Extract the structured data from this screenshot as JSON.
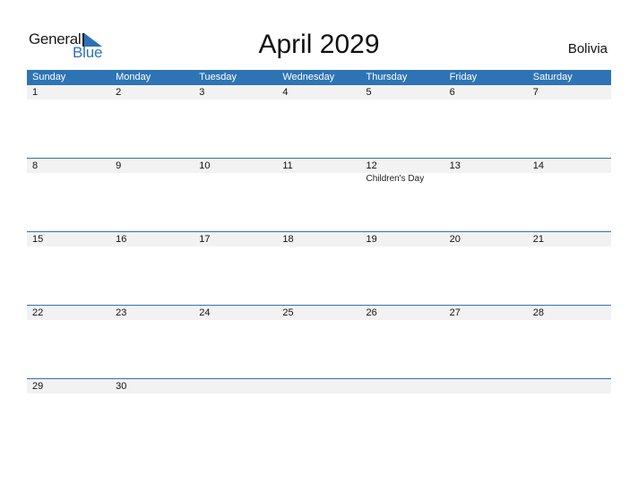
{
  "logo": {
    "part1": "General",
    "part2": "Blue"
  },
  "title": "April 2029",
  "country": "Bolivia",
  "colors": {
    "accent": "#2e74b5",
    "band": "#f2f2f2"
  },
  "weekdays": [
    "Sunday",
    "Monday",
    "Tuesday",
    "Wednesday",
    "Thursday",
    "Friday",
    "Saturday"
  ],
  "weeks": [
    {
      "days": [
        "1",
        "2",
        "3",
        "4",
        "5",
        "6",
        "7"
      ],
      "events": [
        "",
        "",
        "",
        "",
        "",
        "",
        ""
      ]
    },
    {
      "days": [
        "8",
        "9",
        "10",
        "11",
        "12",
        "13",
        "14"
      ],
      "events": [
        "",
        "",
        "",
        "",
        "Children's Day",
        "",
        ""
      ]
    },
    {
      "days": [
        "15",
        "16",
        "17",
        "18",
        "19",
        "20",
        "21"
      ],
      "events": [
        "",
        "",
        "",
        "",
        "",
        "",
        ""
      ]
    },
    {
      "days": [
        "22",
        "23",
        "24",
        "25",
        "26",
        "27",
        "28"
      ],
      "events": [
        "",
        "",
        "",
        "",
        "",
        "",
        ""
      ]
    },
    {
      "days": [
        "29",
        "30",
        "",
        "",
        "",
        "",
        ""
      ],
      "events": [
        "",
        "",
        "",
        "",
        "",
        "",
        ""
      ]
    }
  ]
}
